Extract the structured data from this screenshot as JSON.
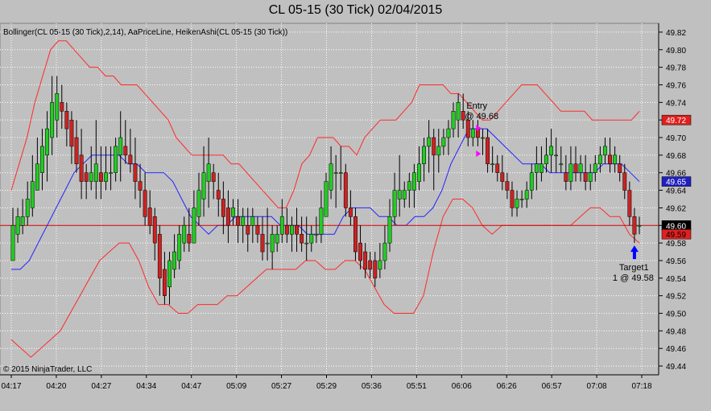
{
  "window": {
    "title": "CL 05-15 (30 Tick)  02/04/2015"
  },
  "indicator_label": "Bollinger(CL 05-15 (30 Tick),2,14), AaPriceLine, HeikenAshi(CL 05-15 (30 Tick))",
  "copyright": "© 2015 NinjaTrader, LLC",
  "colors": {
    "background": "#c0c0c0",
    "up_candle": "#22cc22",
    "down_candle": "#cc2222",
    "bollinger_band": "#ff2a2a",
    "bollinger_mid": "#2222ff",
    "price_line": "#cc0000",
    "grid": "#ffffff"
  },
  "annotations": {
    "entry_label": "Entry",
    "entry_price": "@ 49.68",
    "target_label": "Target1",
    "target_price": "1 @ 49.58"
  },
  "price_markers": [
    {
      "value": 49.72,
      "label": "49.72",
      "bg": "#e02020",
      "fg": "#ffffff"
    },
    {
      "value": 49.65,
      "label": "49.65",
      "bg": "#2020c0",
      "fg": "#ffffff"
    },
    {
      "value": 49.6,
      "label": "49.60",
      "bg": "#000000",
      "fg": "#ffffff"
    },
    {
      "value": 49.59,
      "label": "49.59",
      "bg": "#e02020",
      "fg": "#000000"
    }
  ],
  "chart_data": {
    "type": "candlestick",
    "ylim": [
      49.43,
      49.83
    ],
    "y_ticks": [
      "49.82",
      "49.80",
      "49.78",
      "49.76",
      "49.74",
      "49.72",
      "49.70",
      "49.68",
      "49.66",
      "49.64",
      "49.62",
      "49.60",
      "49.58",
      "49.56",
      "49.54",
      "49.52",
      "49.50",
      "49.48",
      "49.46",
      "49.44"
    ],
    "x_ticks": [
      "04:17",
      "04:20",
      "04:27",
      "04:34",
      "04:47",
      "05:09",
      "05:27",
      "05:29",
      "05:36",
      "05:51",
      "06:06",
      "06:26",
      "06:57",
      "07:08",
      "07:18"
    ],
    "candles_ohlc": [
      [
        49.56,
        49.62,
        49.56,
        49.6
      ],
      [
        49.59,
        49.62,
        49.58,
        49.61
      ],
      [
        49.6,
        49.63,
        49.59,
        49.61
      ],
      [
        49.61,
        49.65,
        49.6,
        49.63
      ],
      [
        49.62,
        49.68,
        49.61,
        49.65
      ],
      [
        49.64,
        49.7,
        49.64,
        49.67
      ],
      [
        49.66,
        49.71,
        49.64,
        49.69
      ],
      [
        49.68,
        49.73,
        49.65,
        49.71
      ],
      [
        49.7,
        49.77,
        49.68,
        49.74
      ],
      [
        49.72,
        49.77,
        49.7,
        49.75
      ],
      [
        49.74,
        49.76,
        49.71,
        49.73
      ],
      [
        49.73,
        49.74,
        49.69,
        49.71
      ],
      [
        49.72,
        49.73,
        49.67,
        49.69
      ],
      [
        49.7,
        49.72,
        49.66,
        49.67
      ],
      [
        49.68,
        49.71,
        49.63,
        49.65
      ],
      [
        49.66,
        49.67,
        49.63,
        49.65
      ],
      [
        49.65,
        49.69,
        49.64,
        49.66
      ],
      [
        49.65,
        49.72,
        49.63,
        49.67
      ],
      [
        49.66,
        49.69,
        49.63,
        49.65
      ],
      [
        49.65,
        49.69,
        49.64,
        49.66
      ],
      [
        49.66,
        49.69,
        49.64,
        49.66
      ],
      [
        49.66,
        49.7,
        49.65,
        49.69
      ],
      [
        49.68,
        49.73,
        49.65,
        49.7
      ],
      [
        49.69,
        49.72,
        49.67,
        49.68
      ],
      [
        49.68,
        49.71,
        49.66,
        49.67
      ],
      [
        49.67,
        49.7,
        49.63,
        49.65
      ],
      [
        49.65,
        49.67,
        49.62,
        49.64
      ],
      [
        49.64,
        49.66,
        49.6,
        49.61
      ],
      [
        49.62,
        49.64,
        49.59,
        49.6
      ],
      [
        49.61,
        49.62,
        49.56,
        49.58
      ],
      [
        49.59,
        49.6,
        49.52,
        49.54
      ],
      [
        49.55,
        49.57,
        49.51,
        49.52
      ],
      [
        49.53,
        49.57,
        49.51,
        49.56
      ],
      [
        49.55,
        49.59,
        49.54,
        49.57
      ],
      [
        49.56,
        49.6,
        49.55,
        49.59
      ],
      [
        49.58,
        49.61,
        49.57,
        49.6
      ],
      [
        49.59,
        49.62,
        49.57,
        49.58
      ],
      [
        49.58,
        49.64,
        49.58,
        49.62
      ],
      [
        49.61,
        49.66,
        49.6,
        49.64
      ],
      [
        49.63,
        49.69,
        49.61,
        49.66
      ],
      [
        49.65,
        49.7,
        49.62,
        49.67
      ],
      [
        49.66,
        49.67,
        49.63,
        49.65
      ],
      [
        49.64,
        49.66,
        49.61,
        49.63
      ],
      [
        49.63,
        49.65,
        49.59,
        49.61
      ],
      [
        49.62,
        49.64,
        49.58,
        49.6
      ],
      [
        49.61,
        49.63,
        49.6,
        49.62
      ],
      [
        49.61,
        49.63,
        49.58,
        49.6
      ],
      [
        49.6,
        49.62,
        49.58,
        49.61
      ],
      [
        49.6,
        49.62,
        49.57,
        49.59
      ],
      [
        49.6,
        49.62,
        49.58,
        49.61
      ],
      [
        49.6,
        49.61,
        49.58,
        49.59
      ],
      [
        49.59,
        49.61,
        49.56,
        49.57
      ],
      [
        49.58,
        49.62,
        49.56,
        49.58
      ],
      [
        49.57,
        49.6,
        49.55,
        49.59
      ],
      [
        49.58,
        49.6,
        49.57,
        49.59
      ],
      [
        49.59,
        49.63,
        49.58,
        49.61
      ],
      [
        49.6,
        49.62,
        49.58,
        49.59
      ],
      [
        49.59,
        49.61,
        49.57,
        49.6
      ],
      [
        49.6,
        49.62,
        49.57,
        49.59
      ],
      [
        49.59,
        49.61,
        49.57,
        49.58
      ],
      [
        49.58,
        49.61,
        49.56,
        49.58
      ],
      [
        49.58,
        49.6,
        49.57,
        49.59
      ],
      [
        49.59,
        49.61,
        49.58,
        49.59
      ],
      [
        49.59,
        49.64,
        49.58,
        49.62
      ],
      [
        49.61,
        49.66,
        49.61,
        49.65
      ],
      [
        49.64,
        49.69,
        49.63,
        49.67
      ],
      [
        49.66,
        49.68,
        49.62,
        49.66
      ],
      [
        49.66,
        49.69,
        49.64,
        49.66
      ],
      [
        49.66,
        49.67,
        49.61,
        49.62
      ],
      [
        49.62,
        49.64,
        49.6,
        49.61
      ],
      [
        49.61,
        49.62,
        49.56,
        49.57
      ],
      [
        49.58,
        49.6,
        49.55,
        49.56
      ],
      [
        49.57,
        49.58,
        49.54,
        49.55
      ],
      [
        49.56,
        49.57,
        49.54,
        49.55
      ],
      [
        49.56,
        49.57,
        49.53,
        49.54
      ],
      [
        49.55,
        49.58,
        49.54,
        49.56
      ],
      [
        49.56,
        49.6,
        49.55,
        49.58
      ],
      [
        49.58,
        49.63,
        49.57,
        49.61
      ],
      [
        49.61,
        49.66,
        49.6,
        49.64
      ],
      [
        49.63,
        49.68,
        49.61,
        49.64
      ],
      [
        49.63,
        49.65,
        49.62,
        49.64
      ],
      [
        49.64,
        49.66,
        49.62,
        49.65
      ],
      [
        49.64,
        49.67,
        49.62,
        49.66
      ],
      [
        49.65,
        49.69,
        49.64,
        49.67
      ],
      [
        49.67,
        49.7,
        49.65,
        49.69
      ],
      [
        49.69,
        49.72,
        49.66,
        49.7
      ],
      [
        49.7,
        49.71,
        49.64,
        49.68
      ],
      [
        49.68,
        49.71,
        49.66,
        49.69
      ],
      [
        49.69,
        49.71,
        49.68,
        49.7
      ],
      [
        49.7,
        49.72,
        49.68,
        49.71
      ],
      [
        49.71,
        49.74,
        49.7,
        49.73
      ],
      [
        49.72,
        49.75,
        49.7,
        49.74
      ],
      [
        49.73,
        49.75,
        49.71,
        49.72
      ],
      [
        49.72,
        49.73,
        49.69,
        49.7
      ],
      [
        49.7,
        49.72,
        49.69,
        49.71
      ],
      [
        49.71,
        49.72,
        49.69,
        49.7
      ],
      [
        49.7,
        49.71,
        49.68,
        49.7
      ],
      [
        49.7,
        49.71,
        49.66,
        49.67
      ],
      [
        49.67,
        49.69,
        49.66,
        49.67
      ],
      [
        49.67,
        49.68,
        49.65,
        49.66
      ],
      [
        49.66,
        49.68,
        49.64,
        49.65
      ],
      [
        49.65,
        49.66,
        49.63,
        49.64
      ],
      [
        49.64,
        49.65,
        49.61,
        49.62
      ],
      [
        49.62,
        49.64,
        49.61,
        49.63
      ],
      [
        49.63,
        49.64,
        49.62,
        49.63
      ],
      [
        49.63,
        49.65,
        49.62,
        49.64
      ],
      [
        49.64,
        49.67,
        49.63,
        49.66
      ],
      [
        49.66,
        49.69,
        49.64,
        49.67
      ],
      [
        49.66,
        49.69,
        49.65,
        49.67
      ],
      [
        49.67,
        49.7,
        49.66,
        49.68
      ],
      [
        49.68,
        49.71,
        49.66,
        49.69
      ],
      [
        49.68,
        49.7,
        49.66,
        49.68
      ],
      [
        49.67,
        49.69,
        49.66,
        49.67
      ],
      [
        49.66,
        49.68,
        49.64,
        49.65
      ],
      [
        49.65,
        49.69,
        49.64,
        49.67
      ],
      [
        49.67,
        49.69,
        49.65,
        49.66
      ],
      [
        49.66,
        49.68,
        49.65,
        49.67
      ],
      [
        49.66,
        49.68,
        49.64,
        49.65
      ],
      [
        49.65,
        49.67,
        49.64,
        49.66
      ],
      [
        49.66,
        49.68,
        49.65,
        49.67
      ],
      [
        49.67,
        49.69,
        49.66,
        49.68
      ],
      [
        49.68,
        49.7,
        49.67,
        49.69
      ],
      [
        49.68,
        49.7,
        49.66,
        49.67
      ],
      [
        49.67,
        49.69,
        49.66,
        49.68
      ],
      [
        49.67,
        49.68,
        49.65,
        49.66
      ],
      [
        49.66,
        49.67,
        49.63,
        49.64
      ],
      [
        49.64,
        49.65,
        49.6,
        49.61
      ],
      [
        49.61,
        49.62,
        49.58,
        49.59
      ],
      [
        49.6,
        49.61,
        49.59,
        49.6
      ]
    ],
    "bollinger_upper": [
      49.64,
      49.67,
      49.7,
      49.74,
      49.77,
      49.8,
      49.81,
      49.81,
      49.8,
      49.79,
      49.78,
      49.78,
      49.77,
      49.77,
      49.76,
      49.76,
      49.76,
      49.75,
      49.74,
      49.73,
      49.72,
      49.7,
      49.69,
      49.68,
      49.68,
      49.68,
      49.68,
      49.68,
      49.67,
      49.67,
      49.66,
      49.65,
      49.64,
      49.63,
      49.62,
      49.62,
      49.64,
      49.67,
      49.68,
      49.7,
      49.7,
      49.7,
      49.69,
      49.69,
      49.68,
      49.7,
      49.71,
      49.72,
      49.72,
      49.72,
      49.73,
      49.74,
      49.76,
      49.76,
      49.76,
      49.76,
      49.75,
      49.75,
      49.74,
      49.73,
      49.72,
      49.72,
      49.73,
      49.74,
      49.75,
      49.76,
      49.76,
      49.76,
      49.75,
      49.74,
      49.73,
      49.73,
      49.73,
      49.73,
      49.72,
      49.72,
      49.72,
      49.72,
      49.72,
      49.72,
      49.73
    ],
    "bollinger_mid": [
      49.55,
      49.55,
      49.56,
      49.58,
      49.6,
      49.62,
      49.64,
      49.66,
      49.67,
      49.68,
      49.68,
      49.68,
      49.68,
      49.67,
      49.67,
      49.66,
      49.66,
      49.66,
      49.65,
      49.63,
      49.61,
      49.6,
      49.59,
      49.6,
      49.6,
      49.61,
      49.61,
      49.61,
      49.61,
      49.61,
      49.6,
      49.6,
      49.6,
      49.59,
      49.59,
      49.59,
      49.59,
      49.61,
      49.62,
      49.62,
      49.62,
      49.61,
      49.61,
      49.6,
      49.6,
      49.61,
      49.61,
      49.62,
      49.64,
      49.67,
      49.69,
      49.71,
      49.71,
      49.71,
      49.7,
      49.69,
      49.68,
      49.67,
      49.67,
      49.67,
      49.66,
      49.66,
      49.66,
      49.66,
      49.66,
      49.66,
      49.67,
      49.67,
      49.67,
      49.66,
      49.65
    ],
    "bollinger_lower": [
      49.47,
      49.46,
      49.45,
      49.46,
      49.47,
      49.48,
      49.5,
      49.52,
      49.54,
      49.56,
      49.57,
      49.58,
      49.58,
      49.56,
      49.53,
      49.51,
      49.51,
      49.5,
      49.5,
      49.51,
      49.51,
      49.51,
      49.52,
      49.52,
      49.53,
      49.54,
      49.55,
      49.55,
      49.55,
      49.55,
      49.56,
      49.56,
      49.55,
      49.55,
      49.56,
      49.56,
      49.55,
      49.53,
      49.51,
      49.5,
      49.5,
      49.5,
      49.52,
      49.57,
      49.61,
      49.63,
      49.63,
      49.62,
      49.6,
      49.59,
      49.6,
      49.6,
      49.6,
      49.6,
      49.6,
      49.6,
      49.6,
      49.6,
      49.61,
      49.62,
      49.62,
      49.61,
      49.61,
      49.59,
      49.58
    ],
    "price_line": 49.6,
    "entry": {
      "index": 94,
      "price": 49.72
    },
    "target": {
      "index": 127,
      "price": 49.58
    }
  }
}
